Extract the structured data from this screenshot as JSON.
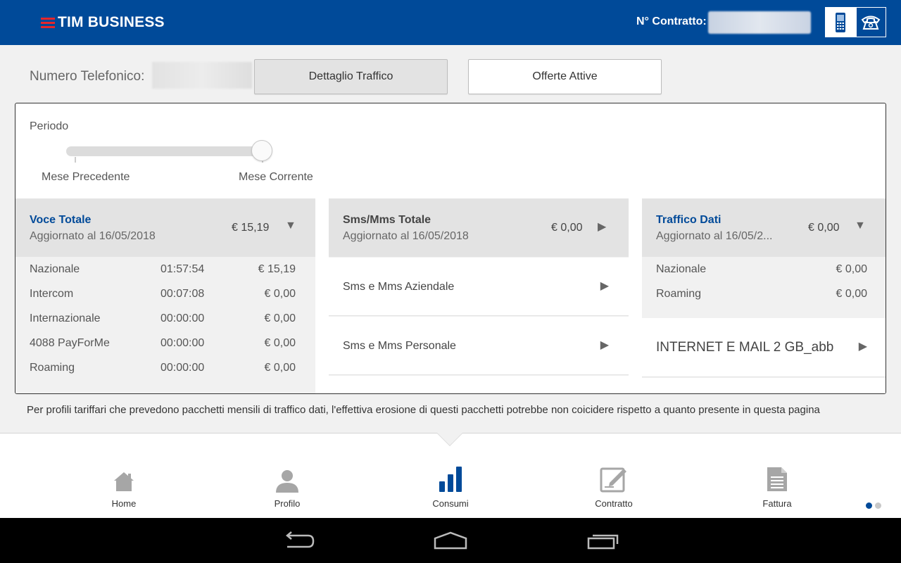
{
  "header": {
    "logo_text": "TIM BUSINESS",
    "contract_label": "N° Contratto:"
  },
  "numero": {
    "label": "Numero Telefonico:"
  },
  "buttons": {
    "dettaglio": "Dettaglio Traffico",
    "offerte": "Offerte Attive"
  },
  "periodo": {
    "label": "Periodo",
    "prev": "Mese Precedente",
    "curr": "Mese Corrente",
    "selected_fraction": 1.0
  },
  "voce": {
    "title": "Voce Totale",
    "updated": "Aggiornato al 16/05/2018",
    "amount": "€ 15,19",
    "arrow": "▼",
    "rows": [
      {
        "name": "Nazionale",
        "time": "01:57:54",
        "value": "€ 15,19"
      },
      {
        "name": "Intercom",
        "time": "00:07:08",
        "value": "€ 0,00"
      },
      {
        "name": "Internazionale",
        "time": "00:00:00",
        "value": "€ 0,00"
      },
      {
        "name": "4088 PayForMe",
        "time": "00:00:00",
        "value": "€ 0,00"
      },
      {
        "name": "Roaming",
        "time": "00:00:00",
        "value": "€ 0,00"
      }
    ]
  },
  "sms": {
    "title": "Sms/Mms Totale",
    "updated": "Aggiornato al 16/05/2018",
    "amount": "€ 0,00",
    "arrow": "▶",
    "items": [
      {
        "label": "Sms e Mms Aziendale",
        "arrow": "▶"
      },
      {
        "label": "Sms e Mms Personale",
        "arrow": "▶"
      }
    ]
  },
  "dati": {
    "title": "Traffico Dati",
    "updated": "Aggiornato al 16/05/2...",
    "amount": "€ 0,00",
    "arrow": "▼",
    "rows": [
      {
        "name": "Nazionale",
        "value": "€ 0,00"
      },
      {
        "name": "Roaming",
        "value": "€ 0,00"
      }
    ],
    "offer": {
      "label": "INTERNET E MAIL 2 GB_abb",
      "arrow": "▶"
    }
  },
  "disclaimer": "Per profili tariffari che prevedono pacchetti mensili di traffico dati, l'effettiva erosione di questi pacchetti potrebbe non coicidere rispetto a quanto presente in questa pagina",
  "nav": {
    "home": "Home",
    "profilo": "Profilo",
    "consumi": "Consumi",
    "contratto": "Contratto",
    "fattura": "Fattura"
  },
  "colors": {
    "brand_blue": "#004a99",
    "brand_red": "#e5262b"
  }
}
